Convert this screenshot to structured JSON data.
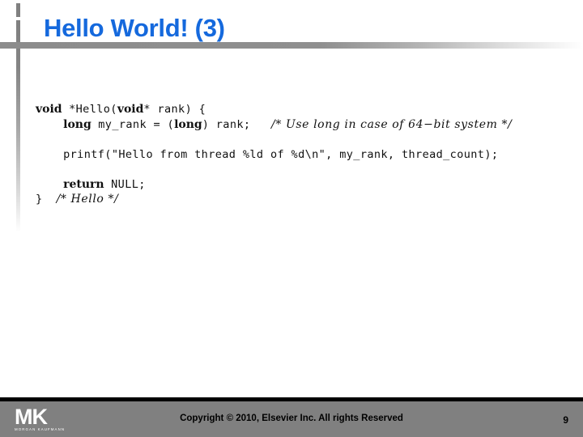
{
  "slide": {
    "title": "Hello World! (3)",
    "title_color": "#1569dd",
    "background_color": "#ffffff"
  },
  "code": {
    "language": "c",
    "lines": [
      {
        "id": "line-1",
        "indent": 0,
        "segments": [
          {
            "style": "keyword",
            "text": "void"
          },
          {
            "style": "mono",
            "text": " *Hello("
          },
          {
            "style": "keyword",
            "text": "void"
          },
          {
            "style": "mono",
            "text": "* rank) {"
          }
        ],
        "plain": "void *Hello(void* rank) {"
      },
      {
        "id": "line-2",
        "indent": 1,
        "segments": [
          {
            "style": "keyword",
            "text": "long"
          },
          {
            "style": "mono",
            "text": " my_rank = ("
          },
          {
            "style": "keyword",
            "text": "long"
          },
          {
            "style": "mono",
            "text": ") rank;   "
          },
          {
            "style": "comment",
            "text": "/* Use long in case of 64−bit system */"
          }
        ],
        "plain": "long my_rank = (long) rank;   /* Use long in case of 64-bit system */"
      },
      {
        "id": "line-3",
        "indent": 0,
        "segments": [],
        "plain": ""
      },
      {
        "id": "line-4",
        "indent": 1,
        "segments": [
          {
            "style": "mono",
            "text": "printf(\"Hello from thread %ld of %d\\n\", my_rank, thread_count);"
          }
        ],
        "plain": "printf(\"Hello from thread %ld of %d\\n\", my_rank, thread_count);"
      },
      {
        "id": "line-5",
        "indent": 0,
        "segments": [],
        "plain": ""
      },
      {
        "id": "line-6",
        "indent": 1,
        "segments": [
          {
            "style": "keyword",
            "text": "return"
          },
          {
            "style": "mono",
            "text": " NULL;"
          }
        ],
        "plain": "return NULL;"
      },
      {
        "id": "line-7",
        "indent": 0,
        "segments": [
          {
            "style": "mono",
            "text": "}  "
          },
          {
            "style": "comment",
            "text": "/* Hello */"
          }
        ],
        "plain": "}  /* Hello */"
      }
    ]
  },
  "footer": {
    "logo_mark": "MK",
    "logo_sub": "MORGAN KAUFMANN",
    "copyright": "Copyright © 2010, Elsevier Inc. All rights Reserved",
    "page_number": "9",
    "bar_color": "#808080"
  }
}
